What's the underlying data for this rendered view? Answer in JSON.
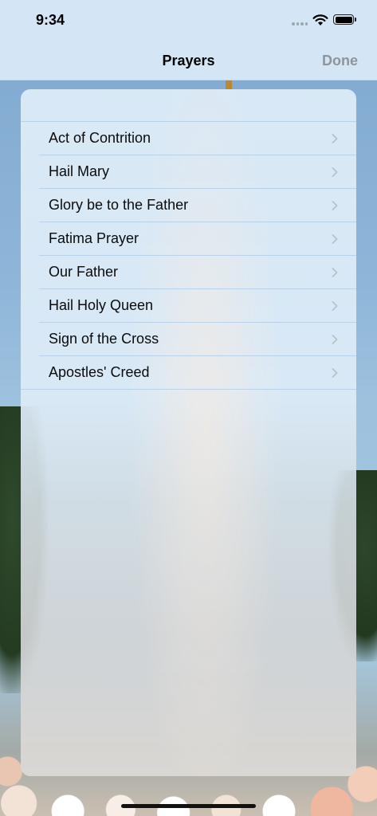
{
  "status_bar": {
    "time": "9:34"
  },
  "nav": {
    "title": "Prayers",
    "done_label": "Done"
  },
  "prayers": {
    "items": [
      {
        "label": "Act of Contrition"
      },
      {
        "label": "Hail Mary"
      },
      {
        "label": "Glory be to the Father"
      },
      {
        "label": "Fatima Prayer"
      },
      {
        "label": "Our Father"
      },
      {
        "label": "Hail Holy Queen"
      },
      {
        "label": "Sign of the Cross"
      },
      {
        "label": "Apostles' Creed"
      }
    ]
  },
  "icons": {
    "row_accessory": "chevron-right-icon"
  },
  "colors": {
    "header_bg": "#d4e6f6",
    "done_disabled": "#8e949a",
    "separator": "#b9d2e8"
  }
}
